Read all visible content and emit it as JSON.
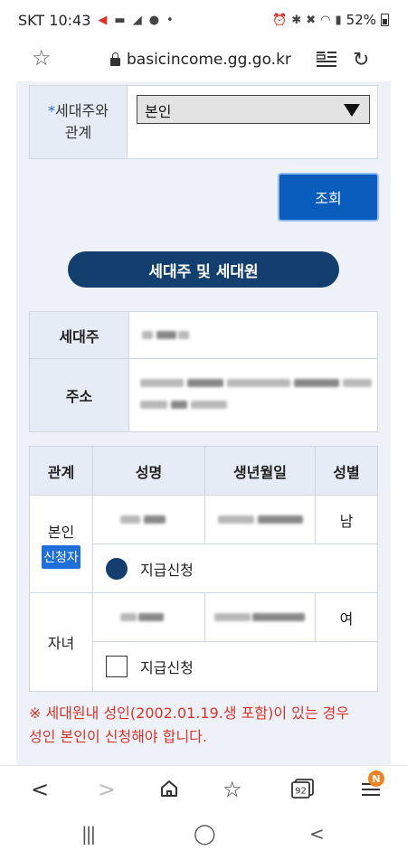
{
  "status": {
    "carrier": "SKT",
    "time": "10:43",
    "battery": "52%"
  },
  "url": {
    "text": "basicincome.gg.go.kr"
  },
  "relation": {
    "label_line1": "세대주와",
    "label_line2": "관계",
    "required_mark": "*",
    "selected": "본인"
  },
  "search_button": "조회",
  "section_title": "세대주 및 세대원",
  "info": {
    "head_label": "세대주",
    "address_label": "주소"
  },
  "members": {
    "headers": [
      "관계",
      "성명",
      "생년월일",
      "성별"
    ],
    "rows": [
      {
        "relation": "본인",
        "badge": "신청자",
        "gender": "남",
        "apply_label": "지급신청",
        "selected": true
      },
      {
        "relation": "자녀",
        "gender": "여",
        "apply_label": "지급신청",
        "selected": false
      }
    ]
  },
  "notice": {
    "line1": "※ 세대원내 성인(2002.01.19.생 포함)이 있는 경우",
    "line2": "성인 본인이 신청해야 합니다."
  },
  "toolbar": {
    "tab_count": "92",
    "notif_badge": "N"
  },
  "colors": {
    "primary": "#0a5dbd",
    "navy": "#123f6e",
    "notice_red": "#d6342a",
    "badge_blue": "#1e6fd9"
  }
}
